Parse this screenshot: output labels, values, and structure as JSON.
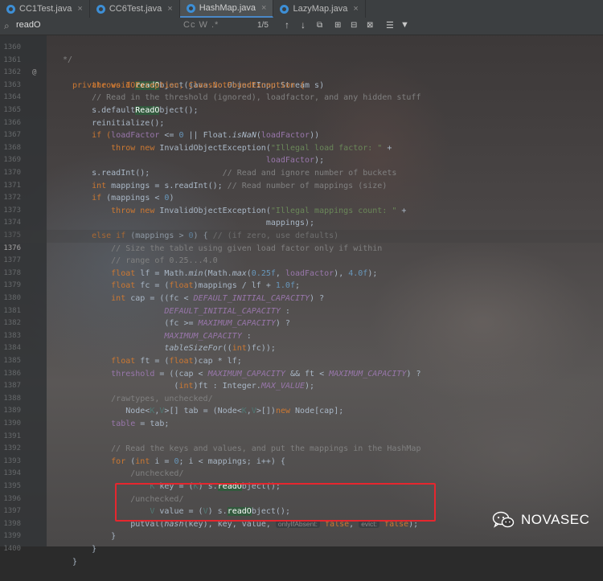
{
  "tabs": [
    {
      "label": "CC1Test.java",
      "active": false
    },
    {
      "label": "CC6Test.java",
      "active": false
    },
    {
      "label": "HashMap.java",
      "active": true
    },
    {
      "label": "LazyMap.java",
      "active": false
    }
  ],
  "find": {
    "query": "readO",
    "options": "Cc  W  .*",
    "count": "1/5"
  },
  "line_numbers": [
    "1360",
    "1361",
    "1362",
    "1363",
    "1364",
    "1365",
    "1366",
    "1367",
    "1368",
    "1369",
    "1370",
    "1371",
    "1372",
    "1373",
    "1374",
    "1375",
    "1376",
    "1377",
    "1378",
    "1379",
    "1380",
    "1381",
    "1382",
    "1383",
    "1384",
    "1385",
    "1386",
    "1387",
    "1388",
    "1389",
    "1390",
    "1391",
    "1392",
    "1393",
    "1394",
    "1395",
    "1396",
    "1397",
    "1398",
    "1399",
    "1400"
  ],
  "current_line": "1376",
  "gutter_annotation": "@",
  "code": {
    "l1361a": "private void ",
    "l1361b": "readO",
    "l1361c": "bject(java.io.ObjectInputStream s)",
    "l1362": "    throws IOException, ClassNotFoundException {",
    "l1363": "    // Read in the threshold (ignored), loadfactor, and any hidden stuff",
    "l1364a": "    s.default",
    "l1364b": "ReadO",
    "l1364c": "bject();",
    "l1365": "    reinitialize();",
    "l1366a": "    if (",
    "l1366b": "loadFactor",
    "l1366c": " <= ",
    "l1366d": "0",
    "l1366e": " || Float.",
    "l1366f": "isNaN",
    "l1366g": "(",
    "l1366h": "loadFactor",
    "l1366i": "))",
    "l1367a": "        throw new ",
    "l1367b": "InvalidObjectException(",
    "l1367c": "\"Illegal load factor: \"",
    "l1367d": " +",
    "l1368a": "                                        ",
    "l1368b": "loadFactor",
    "l1368c": ");",
    "l1369a": "    s.readInt();",
    "l1369b": "               // Read and ignore number of buckets",
    "l1370a": "    int ",
    "l1370b": "mappings = s.readInt(); ",
    "l1370c": "// Read number of mappings (size)",
    "l1371a": "    if ",
    "l1371b": "(mappings < ",
    "l1371c": "0",
    "l1371d": ")",
    "l1372a": "        throw new ",
    "l1372b": "InvalidObjectException(",
    "l1372c": "\"Illegal mappings count: \"",
    "l1372d": " +",
    "l1373": "                                        mappings);",
    "l1374a": "    else if ",
    "l1374b": "(mappings > ",
    "l1374c": "0",
    "l1374d": ") { ",
    "l1374e": "// (if zero, use defaults)",
    "l1375": "        // Size the table using given load factor only if within",
    "l1376": "        // range of 0.25...4.0",
    "l1377a": "        float ",
    "l1377b": "lf = Math.",
    "l1377c": "min",
    "l1377d": "(Math.",
    "l1377e": "max",
    "l1377f": "(",
    "l1377g": "0.25f",
    "l1377h": ", ",
    "l1377i": "loadFactor",
    "l1377j": "), ",
    "l1377k": "4.0f",
    "l1377l": ");",
    "l1378a": "        float ",
    "l1378b": "fc = (",
    "l1378c": "float",
    "l1378d": ")mappings / lf + ",
    "l1378e": "1.0f",
    "l1378f": ";",
    "l1379a": "        int ",
    "l1379b": "cap = ((fc < ",
    "l1379c": "DEFAULT_INITIAL_CAPACITY",
    "l1379d": ") ?",
    "l1380a": "                   ",
    "l1380b": "DEFAULT_INITIAL_CAPACITY",
    "l1380c": " :",
    "l1381a": "                   (fc >= ",
    "l1381b": "MAXIMUM_CAPACITY",
    "l1381c": ") ?",
    "l1382a": "                   ",
    "l1382b": "MAXIMUM_CAPACITY",
    "l1382c": " :",
    "l1383a": "                   ",
    "l1383b": "tableSizeFor",
    "l1383c": "((",
    "l1383d": "int",
    "l1383e": ")fc));",
    "l1384a": "        float ",
    "l1384b": "ft = (",
    "l1384c": "float",
    "l1384d": ")cap * lf;",
    "l1385a": "        ",
    "l1385b": "threshold",
    "l1385c": " = ((cap < ",
    "l1385d": "MAXIMUM_CAPACITY",
    "l1385e": " && ft < ",
    "l1385f": "MAXIMUM_CAPACITY",
    "l1385g": ") ?",
    "l1386a": "                     (",
    "l1386b": "int",
    "l1386c": ")ft : Integer.",
    "l1386d": "MAX_VALUE",
    "l1386e": ");",
    "l1387": "        /rawtypes, unchecked/",
    "l1388a": "           Node<",
    "l1388b": "K",
    "l1388c": ",",
    "l1388d": "V",
    "l1388e": ">[] tab = (Node<",
    "l1388f": "K",
    "l1388g": ",",
    "l1388h": "V",
    "l1388i": ">[])",
    "l1388j": "new ",
    "l1388k": "Node[cap];",
    "l1389a": "        ",
    "l1389b": "table",
    "l1389c": " = tab;",
    "l1390": "",
    "l1391": "        // Read the keys and values, and put the mappings in the HashMap",
    "l1392a": "        for ",
    "l1392b": "(",
    "l1392c": "int ",
    "l1392d": "i = ",
    "l1392e": "0",
    "l1392f": "; i < mappings; i++) {",
    "l1393": "            /unchecked/",
    "l1394a": "                ",
    "l1394b": "K",
    "l1394c": " key = (",
    "l1394d": "K",
    "l1394e": ") s.",
    "l1394f": "readO",
    "l1394g": "bject();",
    "l1395": "            /unchecked/",
    "l1396a": "                ",
    "l1396b": "V",
    "l1396c": " value = (",
    "l1396d": "V",
    "l1396e": ") s.",
    "l1396f": "readO",
    "l1396g": "bject();",
    "l1397a": "            putVal(",
    "l1397b": "hash",
    "l1397c": "(key), key, value, ",
    "l1397d": "onlyIfAbsent:",
    "l1397e": " false",
    "l1397f": ", ",
    "l1397g": "evict:",
    "l1397h": " false",
    "l1397i": ");",
    "l1398": "        }",
    "l1399": "    }",
    "l1400": "}"
  },
  "watermark": "NOVASEC",
  "colors": {
    "keyword": "#cc7832",
    "comment": "#808080",
    "number": "#6897bb",
    "string": "#6a8759",
    "field": "#9876aa",
    "highlight": "#32593d",
    "annotation_box": "#e6262e"
  }
}
